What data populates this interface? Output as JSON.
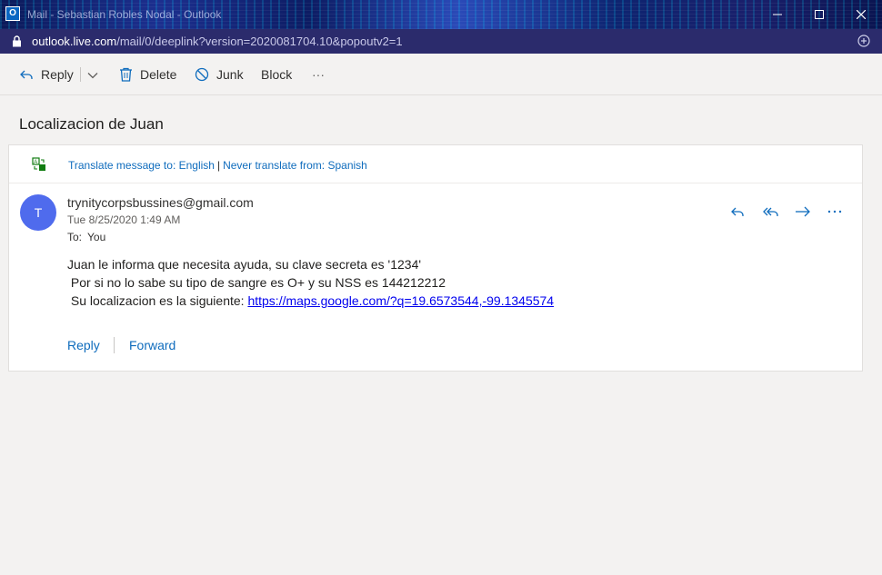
{
  "window": {
    "title": "Mail - Sebastian Robles Nodal - Outlook",
    "app_icon_letter": "O"
  },
  "address_bar": {
    "host": "outlook.live.com",
    "path": "/mail/0/deeplink?version=2020081704.10&popoutv2=1"
  },
  "toolbar": {
    "reply_label": "Reply",
    "delete_label": "Delete",
    "junk_label": "Junk",
    "block_label": "Block",
    "more_label": "···"
  },
  "message": {
    "subject": "Localizacion de Juan",
    "translate_prefix": "Translate message to: English",
    "translate_separator": "|",
    "translate_never": "Never translate from: Spanish",
    "avatar_initial": "T",
    "sender": "trynitycorpsbussines@gmail.com",
    "date": "Tue 8/25/2020 1:49 AM",
    "to_label": "To:",
    "to_value": "You",
    "body_line1": "Juan le informa que necesita ayuda, su clave secreta es '1234'",
    "body_line2": " Por si no lo sabe su tipo de sangre es O+ y su NSS es 144212212",
    "body_line3_prefix": " Su localizacion es la siguiente: ",
    "body_link": "https://maps.google.com/?q=19.6573544,-99.1345574",
    "footer_reply": "Reply",
    "footer_forward": "Forward"
  },
  "icons": {
    "app": "outlook-icon",
    "lock": "lock-icon",
    "extension": "extension-icon",
    "reply": "reply-icon",
    "reply_all": "reply-all-icon",
    "forward": "forward-icon",
    "more": "more-icon",
    "delete": "trash-icon",
    "junk": "block-circle-icon",
    "translate": "translate-icon"
  },
  "colors": {
    "accent": "#0f6cbd",
    "avatar": "#4f6bed",
    "link": "#0000ee",
    "address_bar": "#2b2b6c"
  }
}
